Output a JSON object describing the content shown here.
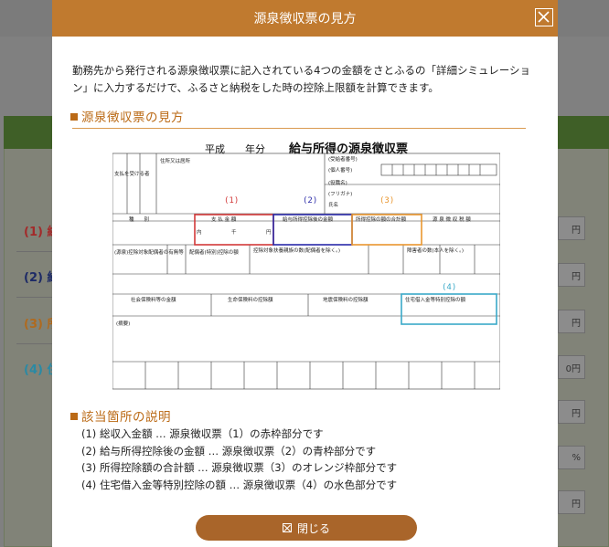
{
  "background": {
    "rows": [
      {
        "marker": "(1)",
        "label": "総",
        "color": "#a32a2a",
        "field": "円"
      },
      {
        "marker": "(2)",
        "label": "給",
        "color": "#1d2a66",
        "field": "円"
      },
      {
        "marker": "(3)",
        "label": "所",
        "color": "#b06a1e",
        "field": "円"
      },
      {
        "marker": "(4)",
        "label": "住",
        "color": "#2a8aa5",
        "field": "0円"
      }
    ],
    "extra_fields": [
      "円",
      "%",
      "円",
      "円"
    ]
  },
  "modal": {
    "title": "源泉徴収票の見方",
    "intro": "勤務先から発行される源泉徴収票に記入されている4つの金額をさとふるの「詳細シミュレーション」に入力するだけで、ふるさと納税をした時の控除上限額を計算できます。",
    "section1_title": "源泉徴収票の見方",
    "section2_title": "該当箇所の説明",
    "close_button": "閉じる"
  },
  "slip": {
    "prefix": "平成　　年分",
    "title": "給与所得の源泉徴収票",
    "markers": [
      {
        "label": "(1)",
        "color": "#d23a3a"
      },
      {
        "label": "(2)",
        "color": "#2a2aa8"
      },
      {
        "label": "(3)",
        "color": "#e9962e"
      },
      {
        "label": "(4)",
        "color": "#3aa9c8"
      }
    ],
    "columns": [
      "種　　別",
      "支 払 金 額",
      "給与所得控除後の金額",
      "所得控除の額の合計額",
      "源 泉 徴 収 税 額"
    ],
    "row_labels": [
      "社会保険料等の金額",
      "生命保険料の控除額",
      "地震保険料の控除額",
      "住宅借入金等特別控除の額"
    ],
    "small_labels": [
      "(源泉)控除対象配偶者の有無等",
      "配偶者(特別)控除の額",
      "控除対象扶養親族の数(配偶者を除く。)",
      "障害者の数(本人を除く。)",
      "(摘要)",
      "内",
      "千",
      "円",
      "(受給者番号)",
      "(個人番号)",
      "(役職名)",
      "(フリガナ)",
      "氏名",
      "支払を受ける者",
      "住所又は居所"
    ]
  },
  "explanations": [
    "(1) 総収入金額 … 源泉徴収票（1）の赤枠部分です",
    "(2) 給与所得控除後の金額 … 源泉徴収票（2）の青枠部分です",
    "(3) 所得控除額の合計額 … 源泉徴収票（3）のオレンジ枠部分です",
    "(4) 住宅借入金等特別控除の額 … 源泉徴収票（4）の水色部分です"
  ]
}
